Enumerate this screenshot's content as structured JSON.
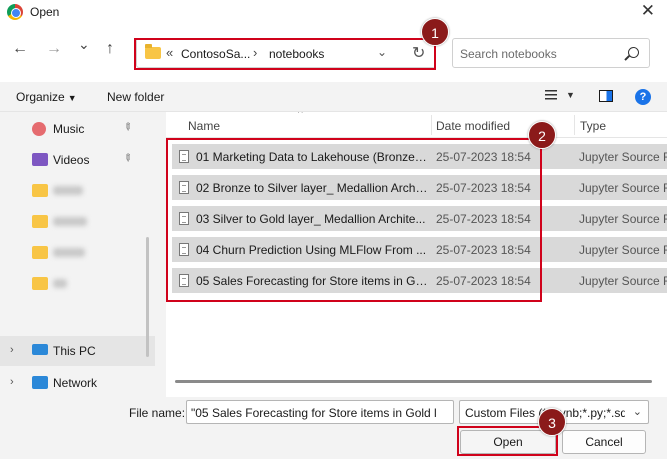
{
  "window": {
    "title": "Open",
    "close_glyph": "✕"
  },
  "nav": {
    "back_glyph": "←",
    "forward_glyph": "→",
    "history_glyph": "⌄",
    "up_glyph": "↑",
    "address": {
      "chevron": "«",
      "segments": [
        "ContosoSa...",
        "notebooks"
      ],
      "separator": "›",
      "dropdown": "⌄",
      "refresh": "↻"
    },
    "search_placeholder": "Search notebooks"
  },
  "toolbar": {
    "organize": "Organize",
    "new_folder": "New folder",
    "help": "?"
  },
  "sidebar": {
    "items": [
      {
        "label": "Music",
        "icon": "music-icon",
        "pinned": true
      },
      {
        "label": "Videos",
        "icon": "videos-icon",
        "pinned": true
      },
      {
        "label": "",
        "icon": "folder-icon",
        "blurred": true
      },
      {
        "label": "",
        "icon": "folder-icon",
        "blurred": true
      },
      {
        "label": "",
        "icon": "folder-icon",
        "blurred": true
      },
      {
        "label": "",
        "icon": "folder-icon",
        "blurred": true
      },
      {
        "label": "This PC",
        "icon": "computer-icon",
        "selected": true
      },
      {
        "label": "Network",
        "icon": "network-icon"
      }
    ],
    "pin_glyph": "📌",
    "expand_glyph": "›"
  },
  "files": {
    "columns": [
      "Name",
      "Date modified",
      "Type"
    ],
    "sort_glyph": "^",
    "rows": [
      {
        "name": "01 Marketing Data to Lakehouse (Bronze)...",
        "date": "25-07-2023 18:54",
        "type": "Jupyter Source F"
      },
      {
        "name": "02 Bronze to Silver layer_ Medallion Archi...",
        "date": "25-07-2023 18:54",
        "type": "Jupyter Source F"
      },
      {
        "name": "03 Silver to Gold layer_ Medallion Archite...",
        "date": "25-07-2023 18:54",
        "type": "Jupyter Source F"
      },
      {
        "name": "04 Churn Prediction Using MLFlow From ...",
        "date": "25-07-2023 18:54",
        "type": "Jupyter Source F"
      },
      {
        "name": "05 Sales Forecasting for Store items in Go...",
        "date": "25-07-2023 18:54",
        "type": "Jupyter Source F"
      }
    ]
  },
  "footer": {
    "file_name_label": "File name:",
    "file_name_value": "\"05 Sales Forecasting for Store items in Gold l",
    "filter_value": "Custom Files (*.ipynb;*.py;*.sql;",
    "filter_dropdown": "⌄",
    "open_label": "Open",
    "cancel_label": "Cancel"
  },
  "annotations": {
    "badges": [
      "1",
      "2",
      "3"
    ],
    "color": "#d0021b"
  }
}
